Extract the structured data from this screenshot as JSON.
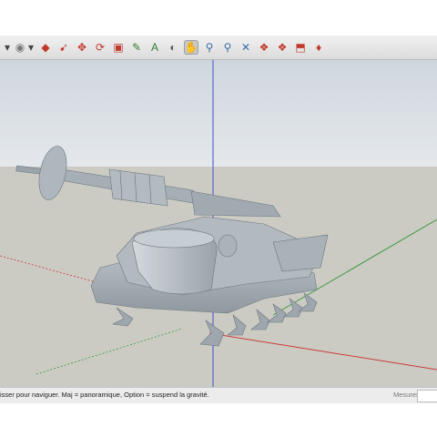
{
  "toolbar": {
    "tools": [
      {
        "icon": "chevron-down-icon",
        "glyph": "▾",
        "color": "#444444",
        "active": false
      },
      {
        "icon": "circle-select-icon",
        "glyph": "◉",
        "color": "#7a7a7a",
        "active": false
      },
      {
        "icon": "chevron-down-icon",
        "glyph": "▾",
        "color": "#444444",
        "active": false
      },
      {
        "icon": "push-pull-icon",
        "glyph": "◆",
        "color": "#c0392b",
        "active": false
      },
      {
        "icon": "follow-me-icon",
        "glyph": "➹",
        "color": "#c0392b",
        "active": false
      },
      {
        "icon": "move-icon",
        "glyph": "✥",
        "color": "#c0392b",
        "active": false
      },
      {
        "icon": "rotate-icon",
        "glyph": "⟳",
        "color": "#c0392b",
        "active": false
      },
      {
        "icon": "scale-icon",
        "glyph": "▣",
        "color": "#c0392b",
        "active": false
      },
      {
        "icon": "tape-measure-icon",
        "glyph": "✎",
        "color": "#2e7d32",
        "active": false
      },
      {
        "icon": "text-icon",
        "glyph": "A",
        "color": "#2e7d32",
        "active": false
      },
      {
        "icon": "orbit-icon",
        "glyph": "◐",
        "color": "#5a5a5a",
        "active": false
      },
      {
        "icon": "pan-icon",
        "glyph": "✋",
        "color": "#5a5a5a",
        "active": true
      },
      {
        "icon": "zoom-icon",
        "glyph": "⚲",
        "color": "#3a6ea5",
        "active": false
      },
      {
        "icon": "zoom-window-icon",
        "glyph": "⚲",
        "color": "#3a6ea5",
        "active": false
      },
      {
        "icon": "zoom-extents-icon",
        "glyph": "✕",
        "color": "#3a6ea5",
        "active": false
      },
      {
        "icon": "warehouse-icon",
        "glyph": "❖",
        "color": "#c0392b",
        "active": false
      },
      {
        "icon": "share-model-icon",
        "glyph": "❖",
        "color": "#c0392b",
        "active": false
      },
      {
        "icon": "extension-warehouse-icon",
        "glyph": "⬒",
        "color": "#c0392b",
        "active": false
      },
      {
        "icon": "ruby-icon",
        "glyph": "♦",
        "color": "#c0392b",
        "active": false
      }
    ]
  },
  "viewport": {
    "sky_color": "#d8dfe5",
    "ground_color": "#c9c9c2",
    "model_color": "#a9b2b9",
    "axis_colors": {
      "red": "#cc3b3b",
      "green": "#3f9a3f",
      "blue": "#3c4fcf"
    }
  },
  "statusbar": {
    "text": "isser pour naviguer. Maj = panoramique, Option =  suspend la gravité.",
    "measurements_label": "Mesures",
    "measurements_value": ""
  }
}
